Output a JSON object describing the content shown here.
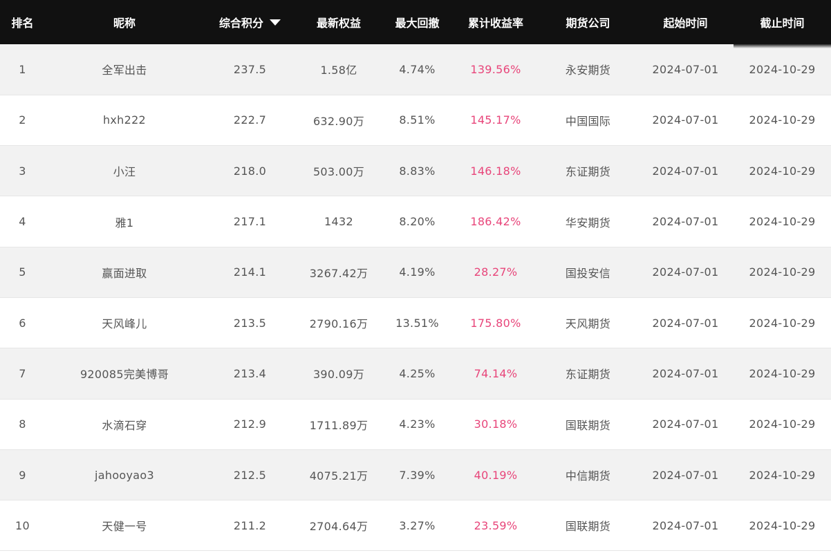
{
  "table": {
    "headers": [
      "排名",
      "昵称",
      "综合积分",
      "最新权益",
      "最大回撤",
      "累计收益率",
      "期货公司",
      "起始时间",
      "截止时间"
    ],
    "sort_column": "综合积分",
    "rate_color": "#e8457a",
    "rows": [
      {
        "rank": "1",
        "name": "全军出击",
        "score": "237.5",
        "equity": "1.58亿",
        "drawdown": "4.74%",
        "return": "139.56%",
        "company": "永安期货",
        "start": "2024-07-01",
        "end": "2024-10-29"
      },
      {
        "rank": "2",
        "name": "hxh222",
        "score": "222.7",
        "equity": "632.90万",
        "drawdown": "8.51%",
        "return": "145.17%",
        "company": "中国国际",
        "start": "2024-07-01",
        "end": "2024-10-29"
      },
      {
        "rank": "3",
        "name": "小汪",
        "score": "218.0",
        "equity": "503.00万",
        "drawdown": "8.83%",
        "return": "146.18%",
        "company": "东证期货",
        "start": "2024-07-01",
        "end": "2024-10-29"
      },
      {
        "rank": "4",
        "name": "雅1",
        "score": "217.1",
        "equity": "1432",
        "drawdown": "8.20%",
        "return": "186.42%",
        "company": "华安期货",
        "start": "2024-07-01",
        "end": "2024-10-29"
      },
      {
        "rank": "5",
        "name": "赢面进取",
        "score": "214.1",
        "equity": "3267.42万",
        "drawdown": "4.19%",
        "return": "28.27%",
        "company": "国投安信",
        "start": "2024-07-01",
        "end": "2024-10-29"
      },
      {
        "rank": "6",
        "name": "天风峰儿",
        "score": "213.5",
        "equity": "2790.16万",
        "drawdown": "13.51%",
        "return": "175.80%",
        "company": "天风期货",
        "start": "2024-07-01",
        "end": "2024-10-29"
      },
      {
        "rank": "7",
        "name": "920085完美博哥",
        "score": "213.4",
        "equity": "390.09万",
        "drawdown": "4.25%",
        "return": "74.14%",
        "company": "东证期货",
        "start": "2024-07-01",
        "end": "2024-10-29"
      },
      {
        "rank": "8",
        "name": "水滴石穿",
        "score": "212.9",
        "equity": "1711.89万",
        "drawdown": "4.23%",
        "return": "30.18%",
        "company": "国联期货",
        "start": "2024-07-01",
        "end": "2024-10-29"
      },
      {
        "rank": "9",
        "name": "jahooyao3",
        "score": "212.5",
        "equity": "4075.21万",
        "drawdown": "7.39%",
        "return": "40.19%",
        "company": "中信期货",
        "start": "2024-07-01",
        "end": "2024-10-29"
      },
      {
        "rank": "10",
        "name": "天健一号",
        "score": "211.2",
        "equity": "2704.64万",
        "drawdown": "3.27%",
        "return": "23.59%",
        "company": "国联期货",
        "start": "2024-07-01",
        "end": "2024-10-29"
      }
    ]
  }
}
